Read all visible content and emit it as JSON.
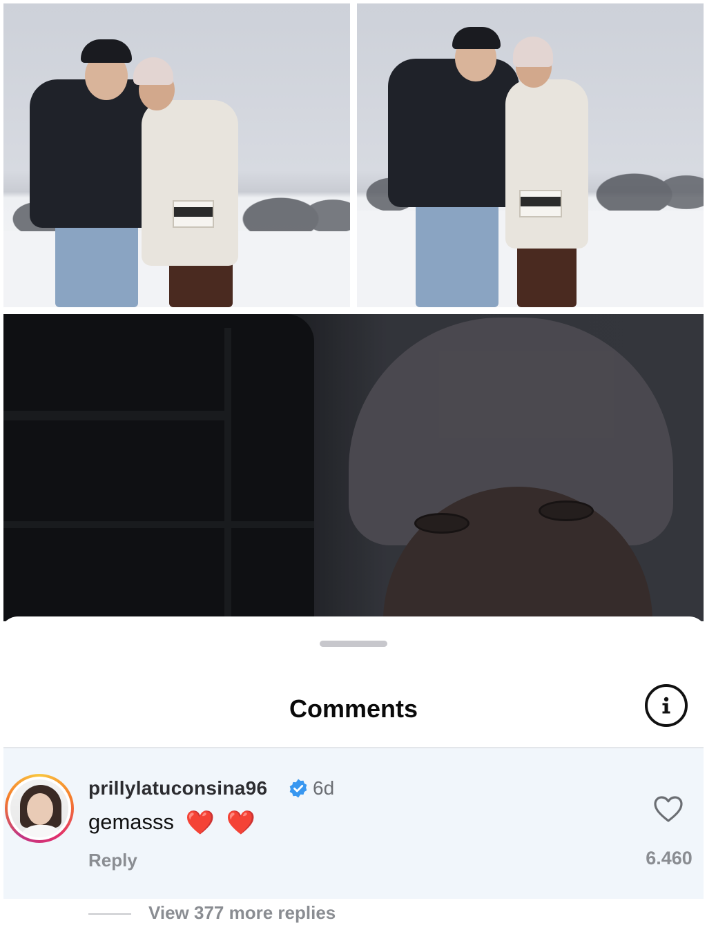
{
  "comments_sheet": {
    "title": "Comments",
    "info_icon": "info-circle-icon",
    "comment": {
      "username": "prillylatuconsina96",
      "verified": true,
      "time_ago": "6d",
      "text": "gemasss",
      "emojis": [
        "❤️",
        "❤️"
      ],
      "reply_label": "Reply",
      "like_icon": "heart-outline-icon",
      "like_count": "6.460"
    },
    "view_replies_label": "View 377 more replies"
  },
  "colors": {
    "verified_blue": "#3897f0",
    "heart_red": "#e0242e",
    "highlight_row": "#f1f6fb",
    "muted_text": "#8a8d92"
  }
}
